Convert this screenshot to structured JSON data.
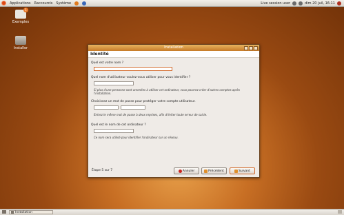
{
  "topbar": {
    "applications": "Applications",
    "places": "Raccourcis",
    "system": "Système",
    "session": "Live session user",
    "clock": "dim 20 juil, 16:11"
  },
  "desktop": {
    "examples_label": "Exemples",
    "install_label": "Installer",
    "examples_badge": "1"
  },
  "dialog": {
    "window_title": "Installation",
    "header": "Identité",
    "q_name": "Quel est votre nom ?",
    "q_username": "Quel nom d'utilisateur voulez-vous utiliser pour vous identifier ?",
    "hint_username": "Si plus d'une personne sont amenées à utiliser cet ordinateur, vous pourrez créer d'autres comptes après l'installation.",
    "q_password": "Choisissez un mot de passe pour protéger votre compte utilisateur.",
    "hint_password": "Entrez le même mot de passe à deux reprises, afin d'éviter toute erreur de saisie.",
    "q_hostname": "Quel est le nom de cet ordinateur ?",
    "hint_hostname": "Ce nom sera utilisé pour identifier l'ordinateur sur un réseau.",
    "step": "Étape 5 sur 7",
    "btn_cancel": "Annuler",
    "btn_back": "Précédent",
    "btn_next": "Suivant"
  },
  "taskbar": {
    "window_item": "Installation"
  },
  "colors": {
    "accent": "#d2692a",
    "titlebar": "#c67a28"
  }
}
